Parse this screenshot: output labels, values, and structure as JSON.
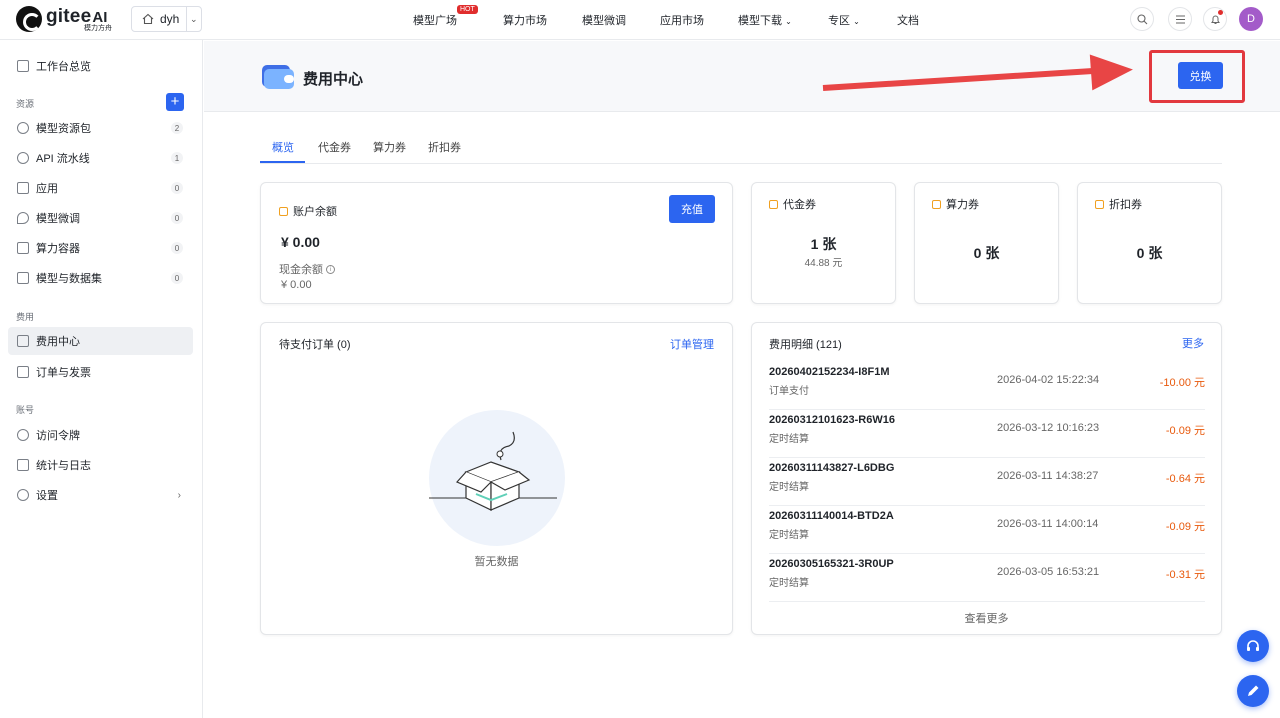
{
  "brand": {
    "name": "gitee",
    "ai": "AI",
    "sub": "模力方舟"
  },
  "workspace": {
    "name": "dyh"
  },
  "nav": {
    "items": [
      "模型广场",
      "算力市场",
      "模型微调",
      "应用市场",
      "模型下载",
      "专区",
      "文档"
    ],
    "hot_badge": "HOT"
  },
  "user": {
    "initial": "D"
  },
  "sidebar": {
    "overview": "工作台总览",
    "section_resources": "资源",
    "resources": [
      {
        "label": "模型资源包",
        "count": "2"
      },
      {
        "label": "API 流水线",
        "count": "1"
      },
      {
        "label": "应用",
        "count": "0"
      },
      {
        "label": "模型微调",
        "count": "0"
      },
      {
        "label": "算力容器",
        "count": "0"
      },
      {
        "label": "模型与数据集",
        "count": "0"
      }
    ],
    "section_billing": "费用",
    "billing": [
      "费用中心",
      "订单与发票"
    ],
    "section_account": "账号",
    "account": [
      "访问令牌",
      "统计与日志",
      "设置"
    ]
  },
  "hero": {
    "title": "费用中心",
    "redeem_label": "兑换"
  },
  "tabs": [
    "概览",
    "代金券",
    "算力券",
    "折扣券"
  ],
  "balance": {
    "label": "账户余额",
    "amount": "¥ 0.00",
    "cash_label": "现金余额",
    "cash_amount": "¥ 0.00",
    "recharge_label": "充值"
  },
  "vouchers": {
    "label": "代金券",
    "count": "1 张",
    "amount": "44.88 元"
  },
  "compute_vouchers": {
    "label": "算力券",
    "count": "0 张"
  },
  "discount_vouchers": {
    "label": "折扣券",
    "count": "0 张"
  },
  "pending_orders": {
    "title": "待支付订单 (0)",
    "manage_link": "订单管理",
    "empty": "暂无数据"
  },
  "billing_details": {
    "title": "费用明细 (121)",
    "more_link": "更多",
    "view_more": "查看更多",
    "rows": [
      {
        "no": "20260402152234-I8F1M",
        "type": "订单支付",
        "date": "2026-04-02  15:22:34",
        "amount": "-10.00 元"
      },
      {
        "no": "20260312101623-R6W16",
        "type": "定时结算",
        "date": "2026-03-12  10:16:23",
        "amount": "-0.09 元"
      },
      {
        "no": "20260311143827-L6DBG",
        "type": "定时结算",
        "date": "2026-03-11  14:38:27",
        "amount": "-0.64 元"
      },
      {
        "no": "20260311140014-BTD2A",
        "type": "定时结算",
        "date": "2026-03-11  14:00:14",
        "amount": "-0.09 元"
      },
      {
        "no": "20260305165321-3R0UP",
        "type": "定时结算",
        "date": "2026-03-05  16:53:21",
        "amount": "-0.31 元"
      }
    ]
  }
}
